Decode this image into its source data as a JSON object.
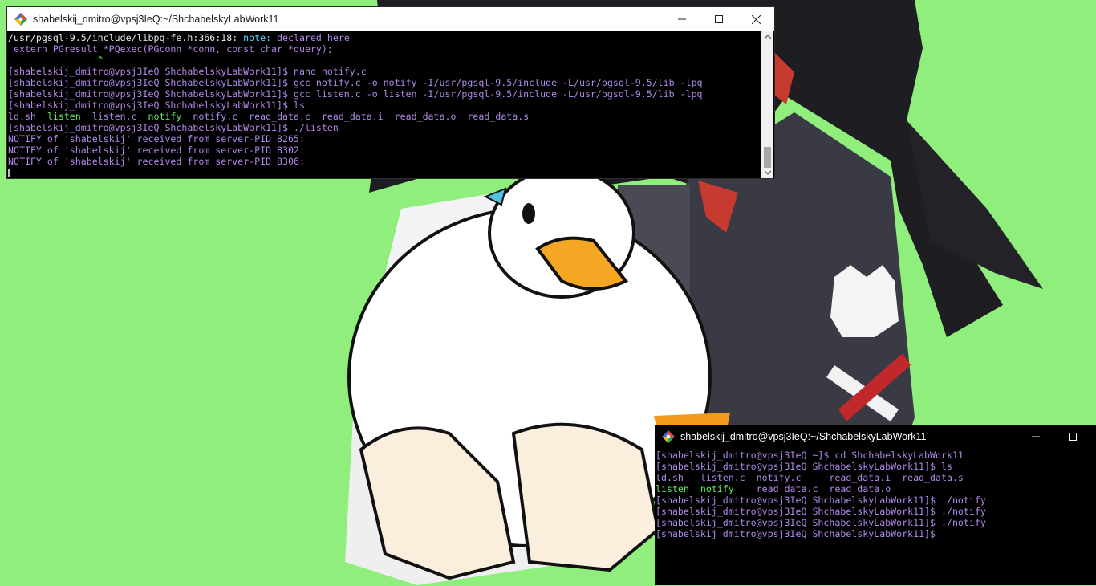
{
  "desktop": {
    "background_color": "#90ee7c",
    "wallpaper_description_icon": "anime-character-holding-duck"
  },
  "window_main": {
    "title": "shabelskij_dmitro@vpsj3IeQ:~/ShchabelskyLabWork11",
    "controls": {
      "minimize": "—",
      "maximize": "☐",
      "close": "✕"
    },
    "lines": [
      [
        {
          "t": "/usr/pgsql-9.5/include/libpq-fe.h:366:18: ",
          "c": "white"
        },
        {
          "t": "note: ",
          "c": "cyan"
        },
        {
          "t": "declared here",
          "c": "purple"
        }
      ],
      [
        {
          "t": " extern PGresult *PQexec(PGconn *conn, const char *query);",
          "c": "purple"
        }
      ],
      [
        {
          "t": "                ^",
          "c": "green"
        }
      ],
      [
        {
          "t": "[shabelskij_dmitro@vpsj3IeQ ShchabelskyLabWork11]$ nano notify.c",
          "c": "purple"
        }
      ],
      [
        {
          "t": "[shabelskij_dmitro@vpsj3IeQ ShchabelskyLabWork11]$ gcc notify.c -o notify -I/usr/pgsql-9.5/include -L/usr/pgsql-9.5/lib -lpq",
          "c": "purple"
        }
      ],
      [
        {
          "t": "[shabelskij_dmitro@vpsj3IeQ ShchabelskyLabWork11]$ gcc listen.c -o listen -I/usr/pgsql-9.5/include -L/usr/pgsql-9.5/lib -lpq",
          "c": "purple"
        }
      ],
      [
        {
          "t": "[shabelskij_dmitro@vpsj3IeQ ShchabelskyLabWork11]$ ls",
          "c": "purple"
        }
      ],
      [
        {
          "t": "ld.sh  ",
          "c": "purple"
        },
        {
          "t": "listen",
          "c": "green"
        },
        {
          "t": "  listen.c  ",
          "c": "purple"
        },
        {
          "t": "notify",
          "c": "green"
        },
        {
          "t": "  notify.c  read_data.c  read_data.i  read_data.o  read_data.s",
          "c": "purple"
        }
      ],
      [
        {
          "t": "[shabelskij_dmitro@vpsj3IeQ ShchabelskyLabWork11]$ ./listen",
          "c": "purple"
        }
      ],
      [
        {
          "t": "NOTIFY of 'shabelskij' received from server-PID 8265:",
          "c": "purple"
        }
      ],
      [
        {
          "t": "NOTIFY of 'shabelskij' received from server-PID 8302:",
          "c": "purple"
        }
      ],
      [
        {
          "t": "NOTIFY of 'shabelskij' received from server-PID 8306:",
          "c": "purple"
        }
      ]
    ],
    "scroll_position": 0.9
  },
  "window_secondary": {
    "title": "shabelskij_dmitro@vpsj3IeQ:~/ShchabelskyLabWork11",
    "controls": {
      "minimize": "—",
      "maximize": "☐"
    },
    "lines": [
      [
        {
          "t": "[shabelskij_dmitro@vpsj3IeQ ~]$ cd ShchabelskyLabWork11",
          "c": "purple"
        }
      ],
      [
        {
          "t": "[shabelskij_dmitro@vpsj3IeQ ShchabelskyLabWork11]$ ls",
          "c": "purple"
        }
      ],
      [
        {
          "t": "ld.sh   listen.c  notify.c     read_data.i  read_data.s",
          "c": "purple"
        }
      ],
      [
        {
          "t": "listen",
          "c": "green"
        },
        {
          "t": "  ",
          "c": "purple"
        },
        {
          "t": "notify",
          "c": "green"
        },
        {
          "t": "    read_data.c  read_data.o",
          "c": "purple"
        }
      ],
      [
        {
          "t": "[shabelskij_dmitro@vpsj3IeQ ShchabelskyLabWork11]$ ./notify",
          "c": "purple"
        }
      ],
      [
        {
          "t": "[shabelskij_dmitro@vpsj3IeQ ShchabelskyLabWork11]$ ./notify",
          "c": "purple"
        }
      ],
      [
        {
          "t": "[shabelskij_dmitro@vpsj3IeQ ShchabelskyLabWork11]$ ./notify",
          "c": "purple"
        }
      ],
      [
        {
          "t": "[shabelskij_dmitro@vpsj3IeQ ShchabelskyLabWork11]$ ",
          "c": "purple"
        }
      ]
    ]
  },
  "colors": {
    "purple": "#b088e8",
    "green": "#5ff05f",
    "cyan": "#5fd7ff",
    "white": "#e6e6e6"
  }
}
